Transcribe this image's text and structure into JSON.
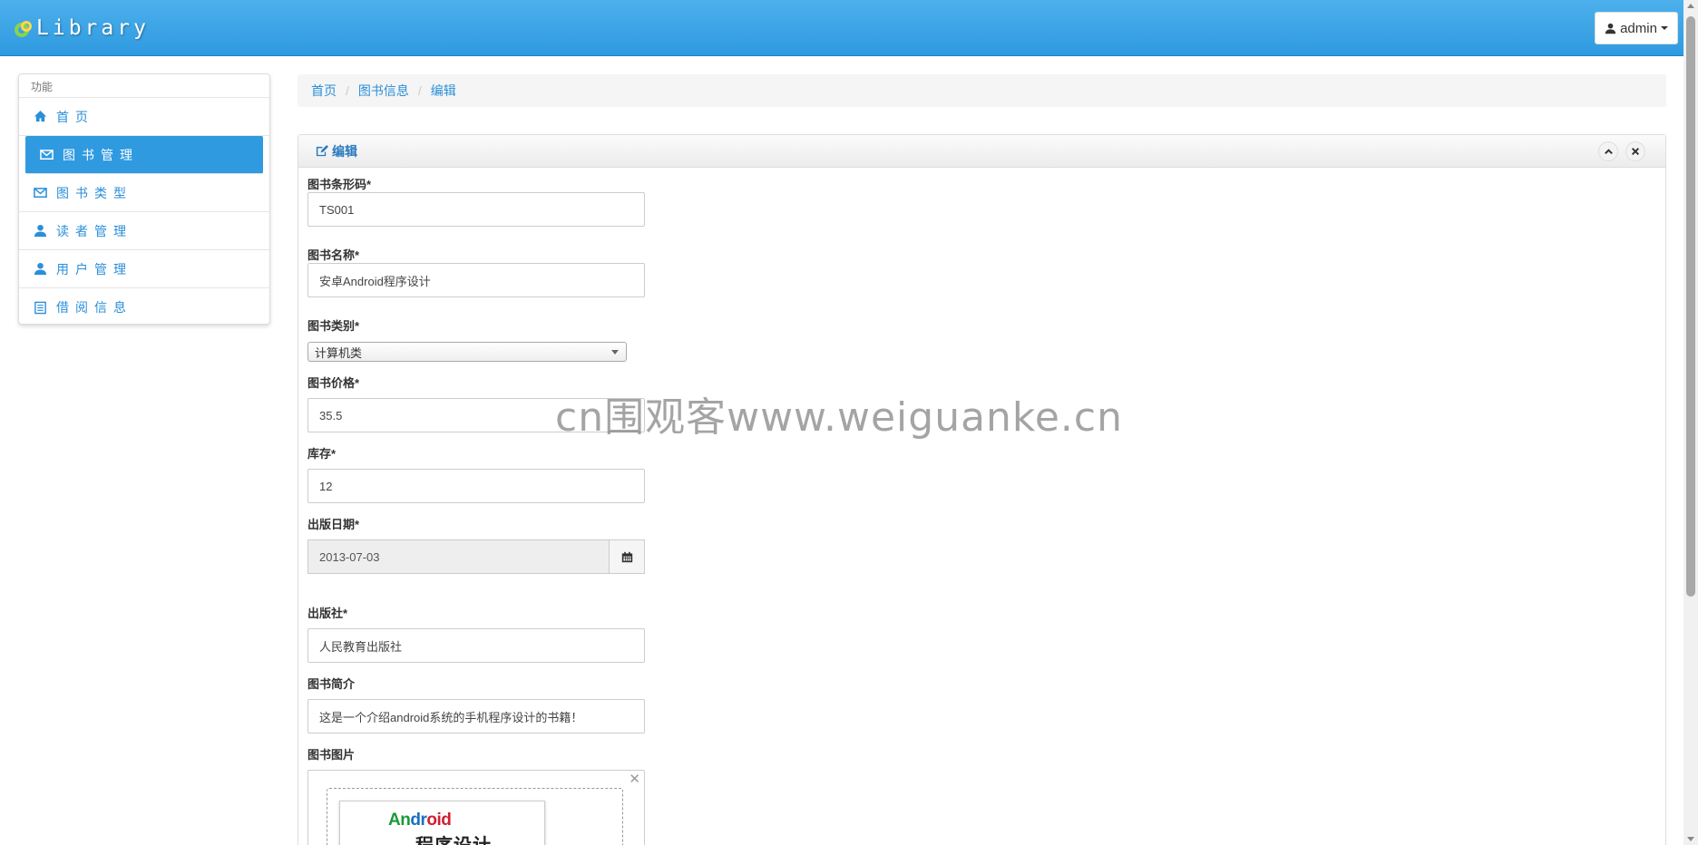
{
  "app": {
    "brand": "Library",
    "user": "admin"
  },
  "sidebar": {
    "header": "功能",
    "items": [
      {
        "label": "首页",
        "icon": "home-icon"
      },
      {
        "label": "图书管理",
        "icon": "envelope-icon",
        "active": true
      },
      {
        "label": "图书类型",
        "icon": "envelope-icon"
      },
      {
        "label": "读者管理",
        "icon": "user-icon"
      },
      {
        "label": "用户管理",
        "icon": "user-icon"
      },
      {
        "label": "借阅信息",
        "icon": "list-icon"
      }
    ]
  },
  "breadcrumb": [
    "首页",
    "图书信息",
    "编辑"
  ],
  "panel": {
    "title": "编辑"
  },
  "form": {
    "barcode": {
      "label": "图书条形码*",
      "value": "TS001"
    },
    "name": {
      "label": "图书名称*",
      "value": "安卓Android程序设计"
    },
    "category": {
      "label": "图书类别*",
      "value": "计算机类"
    },
    "price": {
      "label": "图书价格*",
      "value": "35.5"
    },
    "stock": {
      "label": "库存*",
      "value": "12"
    },
    "publish_date": {
      "label": "出版日期*",
      "value": "2013-07-03"
    },
    "publisher": {
      "label": "出版社*",
      "value": "人民教育出版社"
    },
    "intro": {
      "label": "图书简介",
      "value": "这是一个介绍android系统的手机程序设计的书籍！"
    },
    "image": {
      "label": "图书图片",
      "cover_title": "Android",
      "cover_subtitle": "程序设计"
    }
  },
  "watermark": "cn围观客www.weiguanke.cn",
  "colors": {
    "accent": "#2f9ae0",
    "link": "#2a8fd8"
  }
}
